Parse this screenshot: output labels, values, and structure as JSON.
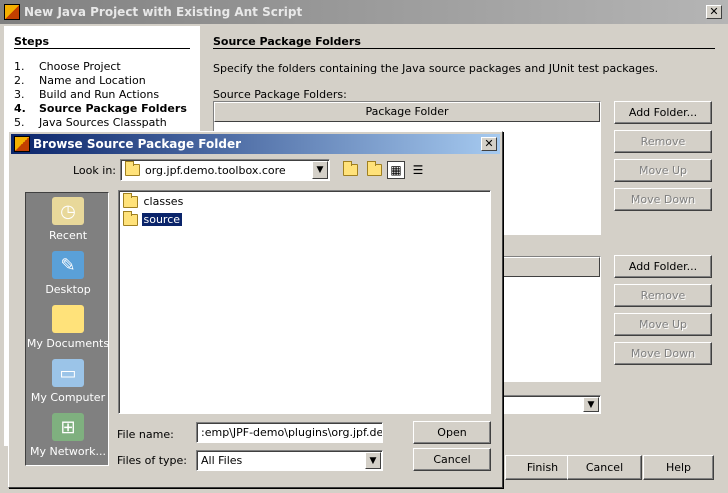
{
  "window": {
    "title": "New Java Project with Existing Ant Script",
    "close_glyph": "✕"
  },
  "steps": {
    "title": "Steps",
    "items": [
      {
        "num": "1.",
        "label": "Choose Project"
      },
      {
        "num": "2.",
        "label": "Name and Location"
      },
      {
        "num": "3.",
        "label": "Build and Run Actions"
      },
      {
        "num": "4.",
        "label": "Source Package Folders"
      },
      {
        "num": "5.",
        "label": "Java Sources Classpath"
      }
    ],
    "current_index": 3
  },
  "panel": {
    "title": "Source Package Folders",
    "description": "Specify the folders containing the Java source packages and JUnit test packages.",
    "source_label": "Source Package Folders:",
    "source_column": "Package Folder",
    "source_buttons": {
      "add": "Add Folder...",
      "remove": "Remove",
      "move_up": "Move Up",
      "move_down": "Move Down"
    },
    "test_buttons": {
      "add": "Add Folder...",
      "remove": "Remove",
      "move_up": "Move Up",
      "move_down": "Move Down"
    }
  },
  "footer": {
    "finish": "Finish",
    "cancel": "Cancel",
    "help": "Help"
  },
  "dialog": {
    "title": "Browse Source Package Folder",
    "close_glyph": "✕",
    "look_in_label": "Look in:",
    "look_in_value": "org.jpf.demo.toolbox.core",
    "toolbar_icons": [
      "up-one-level-icon",
      "new-folder-icon",
      "list-view-icon",
      "details-view-icon"
    ],
    "places": [
      {
        "label": "Recent",
        "icon": "recent-icon"
      },
      {
        "label": "Desktop",
        "icon": "desktop-icon"
      },
      {
        "label": "My Documents",
        "icon": "my-documents-icon"
      },
      {
        "label": "My Computer",
        "icon": "my-computer-icon"
      },
      {
        "label": "My Network...",
        "icon": "my-network-icon"
      }
    ],
    "files": [
      {
        "name": "classes",
        "selected": false
      },
      {
        "name": "source",
        "selected": true
      }
    ],
    "file_name_label": "File name:",
    "file_name_value": ":emp\\JPF-demo\\plugins\\org.jpf.demo.",
    "files_of_type_label": "Files of type:",
    "files_of_type_value": "All Files",
    "open_button": "Open",
    "cancel_button": "Cancel"
  },
  "colors": {
    "active_title": "#0a246a",
    "inactive_title": "#808080",
    "selection": "#0a246a",
    "window_bg": "#d4d0c8"
  }
}
